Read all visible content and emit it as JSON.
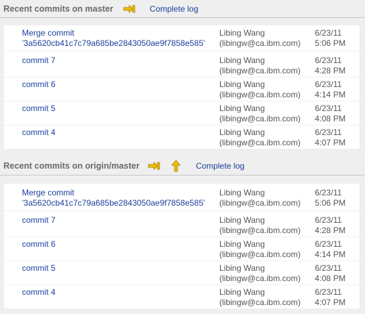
{
  "sections": [
    {
      "title": "Recent commits on master",
      "complete_log": "Complete log",
      "icons": [
        "fetch-icon"
      ],
      "commits": [
        {
          "message": [
            "Merge commit",
            "'3a5620cb41c7c79a685be2843050ae9f7858e585'"
          ],
          "author": [
            "Libing Wang",
            "(libingw@ca.ibm.com)"
          ],
          "date": [
            "6/23/11",
            "5:06 PM"
          ]
        },
        {
          "message": [
            "commit 7"
          ],
          "author": [
            "Libing Wang",
            "(libingw@ca.ibm.com)"
          ],
          "date": [
            "6/23/11",
            "4:28 PM"
          ]
        },
        {
          "message": [
            "commit 6"
          ],
          "author": [
            "Libing Wang",
            "(libingw@ca.ibm.com)"
          ],
          "date": [
            "6/23/11",
            "4:14 PM"
          ]
        },
        {
          "message": [
            "commit 5"
          ],
          "author": [
            "Libing Wang",
            "(libingw@ca.ibm.com)"
          ],
          "date": [
            "6/23/11",
            "4:08 PM"
          ]
        },
        {
          "message": [
            "commit 4"
          ],
          "author": [
            "Libing Wang",
            "(libingw@ca.ibm.com)"
          ],
          "date": [
            "6/23/11",
            "4:07 PM"
          ]
        }
      ]
    },
    {
      "title": "Recent commits on origin/master",
      "complete_log": "Complete log",
      "icons": [
        "fetch-icon",
        "push-icon"
      ],
      "commits": [
        {
          "message": [
            "Merge commit",
            "'3a5620cb41c7c79a685be2843050ae9f7858e585'"
          ],
          "author": [
            "Libing Wang",
            "(libingw@ca.ibm.com)"
          ],
          "date": [
            "6/23/11",
            "5:06 PM"
          ]
        },
        {
          "message": [
            "commit 7"
          ],
          "author": [
            "Libing Wang",
            "(libingw@ca.ibm.com)"
          ],
          "date": [
            "6/23/11",
            "4:28 PM"
          ]
        },
        {
          "message": [
            "commit 6"
          ],
          "author": [
            "Libing Wang",
            "(libingw@ca.ibm.com)"
          ],
          "date": [
            "6/23/11",
            "4:14 PM"
          ]
        },
        {
          "message": [
            "commit 5"
          ],
          "author": [
            "Libing Wang",
            "(libingw@ca.ibm.com)"
          ],
          "date": [
            "6/23/11",
            "4:08 PM"
          ]
        },
        {
          "message": [
            "commit 4"
          ],
          "author": [
            "Libing Wang",
            "(libingw@ca.ibm.com)"
          ],
          "date": [
            "6/23/11",
            "4:07 PM"
          ]
        }
      ]
    }
  ],
  "colors": {
    "link": "#1d3f9c",
    "icon": "#e6b800"
  }
}
